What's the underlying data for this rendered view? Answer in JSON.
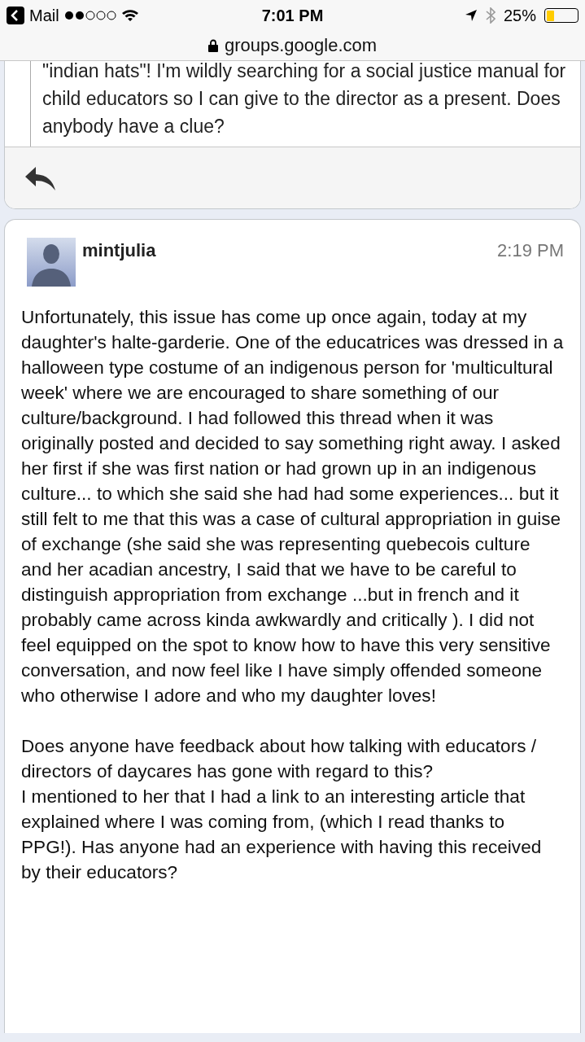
{
  "status_bar": {
    "back_label": "Mail",
    "time": "7:01 PM",
    "battery_percent": "25%",
    "battery": {
      "level": 0.25
    }
  },
  "address_bar": {
    "url": "groups.google.com"
  },
  "previous_post": {
    "quote": "\"indian hats\"! I'm wildly searching for a social justice manual for child educators so I can give to the director as a present. Does anybody have a clue?"
  },
  "post": {
    "author": "mintjulia",
    "time": "2:19 PM",
    "paragraphs": [
      [
        "Unfortunately, this issue has come up once again, today at my daughter's halte-garderie. One of the educatrices was dressed in a halloween type costume of an indigenous person for 'multicultural week' where we are encouraged to share something of our culture/background.  I had followed this thread when it was originally posted and decided to say something right away.  I asked her first if she was first nation or had grown up in an indigenous culture... to which she said she had had some experiences... but it still felt to me that this was a case of cultural appropriation in guise of exchange (she said she was representing quebecois culture and her acadian ancestry, I said that we have to be careful to distinguish appropriation from exchange ...but in french and it probably came across kinda awkwardly and critically ).  I did not feel equipped on the spot to know how to have this very sensitive conversation, and now feel like I have simply offended someone who otherwise I adore and who my daughter loves!"
      ],
      [
        "Does anyone have feedback about how talking with educators / directors of daycares has gone with regard to this?",
        "I mentioned to her that I had a link to an interesting article that explained where I was coming from, (which I read thanks to PPG!).  Has anyone had an experience with having this received by their educators?"
      ]
    ]
  }
}
